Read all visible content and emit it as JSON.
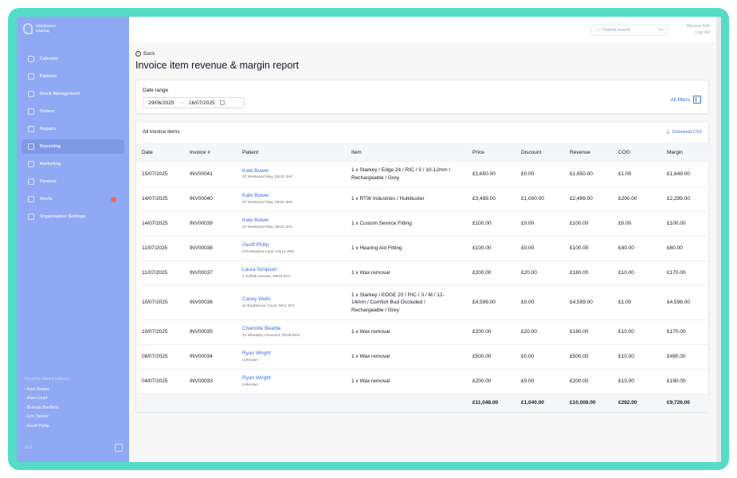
{
  "sidebar": {
    "logo": [
      "Whiteboard",
      "Hearing"
    ],
    "nav": [
      {
        "label": "Calendar",
        "icon": "calendar-icon",
        "active": false,
        "badge": false
      },
      {
        "label": "Patients",
        "icon": "user-icon",
        "active": false,
        "badge": false
      },
      {
        "label": "Stock Management",
        "icon": "box-icon",
        "active": false,
        "badge": false
      },
      {
        "label": "Orders",
        "icon": "cart-icon",
        "active": false,
        "badge": false
      },
      {
        "label": "Repairs",
        "icon": "wrench-icon",
        "active": false,
        "badge": false
      },
      {
        "label": "Reporting",
        "icon": "chart-icon",
        "active": true,
        "badge": false
      },
      {
        "label": "Marketing",
        "icon": "mail-icon",
        "active": false,
        "badge": false
      },
      {
        "label": "Finance",
        "icon": "wallet-icon",
        "active": false,
        "badge": false
      },
      {
        "label": "Alerts",
        "icon": "bell-icon",
        "active": false,
        "badge": true
      },
      {
        "label": "Organisation Settings",
        "icon": "gear-icon",
        "active": false,
        "badge": false
      }
    ],
    "recent_title": "Recently viewed patients",
    "recent": [
      "- Kate Bower",
      "- Alan Lloyd",
      "- Brenda Sheffield",
      "- Eric Tanner",
      "- Geoff Philip"
    ],
    "footer": "v1.0"
  },
  "topbar": {
    "search_placeholder": "Patient search",
    "search_shortcut": "⌘K",
    "user_name": "Marcus Kirk",
    "logout": "Log out"
  },
  "page": {
    "back_label": "Back",
    "title": "Invoice item revenue & margin report"
  },
  "filters": {
    "label": "Date range",
    "start": "29/06/2025",
    "arrow": "→",
    "end": "16/07/2025",
    "all_filters": "All filters"
  },
  "table": {
    "heading": "All invoice items",
    "download": "Download CSV",
    "columns": [
      "Date",
      "Invoice #",
      "Patient",
      "Item",
      "Price",
      "Discount",
      "Revenue",
      "COG",
      "Margin"
    ],
    "rows": [
      {
        "date": "15/07/2025",
        "invoice": "INV00041",
        "patient": "Kate Bower",
        "address": "37 Westward Way, DE22 3HC",
        "item": "1 x Starkey / Edge 24 / RIC / 3 / 10-12mm / Rechargeable / Grey",
        "price": "£1,650.00",
        "discount": "£0.00",
        "revenue": "£1,650.00",
        "cog": "£1.00",
        "margin": "£1,649.00"
      },
      {
        "date": "14/07/2025",
        "invoice": "INV00040",
        "patient": "Kate Bower",
        "address": "37 Westward Way, DE22 3HC",
        "item": "1 x RTW Industries / Hulkbuster",
        "price": "£3,499.00",
        "discount": "£1,000.00",
        "revenue": "£2,499.00",
        "cog": "£200.00",
        "margin": "£2,299.00"
      },
      {
        "date": "14/07/2025",
        "invoice": "INV00039",
        "patient": "Kate Bower",
        "address": "37 Westward Way, DE22 3HC",
        "item": "1 x Custom Service Fitting",
        "price": "£100.00",
        "discount": "£0.00",
        "revenue": "£100.00",
        "cog": "£0.00",
        "margin": "£100.00"
      },
      {
        "date": "11/07/2025",
        "invoice": "INV00038",
        "patient": "Geoff Philip",
        "address": "276 Meadow Lane, NG14 3RX",
        "item": "1 x Hearing Aid Fitting",
        "price": "£100.00",
        "discount": "£0.00",
        "revenue": "£100.00",
        "cog": "£40.00",
        "margin": "£60.00"
      },
      {
        "date": "11/07/2025",
        "invoice": "INV00037",
        "patient": "Laura Simpson",
        "address": "4 Suffolk Avenue, DE24 8UY",
        "item": "1 x Wax removal",
        "price": "£200.00",
        "discount": "£20.00",
        "revenue": "£180.00",
        "cog": "£10.00",
        "margin": "£170.00"
      },
      {
        "date": "10/07/2025",
        "invoice": "INV00036",
        "patient": "Casey Wells",
        "address": "11 Brightmoor Court, NG1 1FG",
        "item": "1 x Starkey / EDGE 20 / RIC / 3 / M / 12-14mm / Comfort Bud Occluded / Rechargeable / Grey",
        "price": "£4,599.00",
        "discount": "£0.00",
        "revenue": "£4,599.00",
        "cog": "£1.00",
        "margin": "£4,598.00"
      },
      {
        "date": "10/07/2025",
        "invoice": "INV00035",
        "patient": "Charlotte Beattie",
        "address": "21 Wheatley Crescent, PE28 5XN",
        "item": "1 x Wax removal",
        "price": "£200.00",
        "discount": "£20.00",
        "revenue": "£180.00",
        "cog": "£10.00",
        "margin": "£170.00"
      },
      {
        "date": "08/07/2025",
        "invoice": "INV00034",
        "patient": "Ryan Wright",
        "address": "Unknown",
        "item": "1 x Wax removal",
        "price": "£500.00",
        "discount": "£0.00",
        "revenue": "£500.00",
        "cog": "£10.00",
        "margin": "£490.00"
      },
      {
        "date": "04/07/2025",
        "invoice": "INV00033",
        "patient": "Ryan Wright",
        "address": "Unknown",
        "item": "1 x Wax removal",
        "price": "£200.00",
        "discount": "£0.00",
        "revenue": "£200.00",
        "cog": "£10.00",
        "margin": "£190.00"
      }
    ],
    "totals": {
      "price": "£11,048.00",
      "discount": "£1,040.00",
      "revenue": "£10,008.00",
      "cog": "£282.00",
      "margin": "£9,726.00"
    }
  }
}
